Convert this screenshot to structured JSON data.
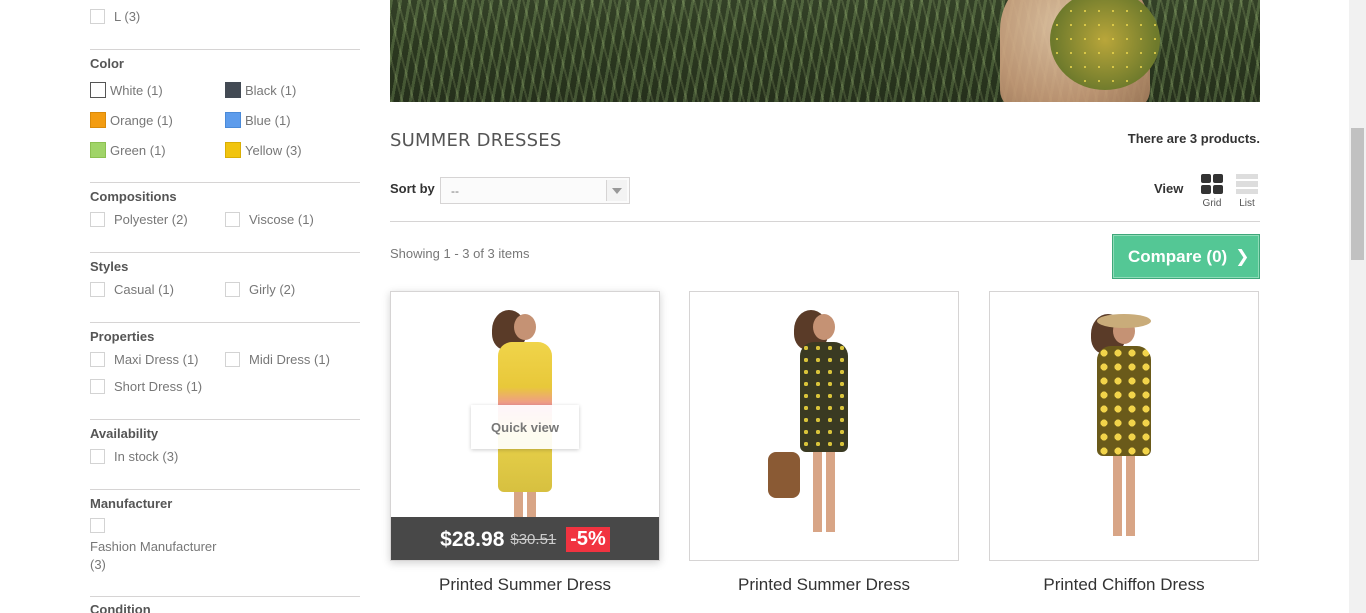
{
  "sidebar": {
    "size": {
      "item_l": "L (3)"
    },
    "color": {
      "title": "Color",
      "items": [
        {
          "label": "White (1)",
          "hex": "#ffffff"
        },
        {
          "label": "Black (1)",
          "hex": "#434a54"
        },
        {
          "label": "Orange (1)",
          "hex": "#f39c11"
        },
        {
          "label": "Blue (1)",
          "hex": "#5d9cec"
        },
        {
          "label": "Green (1)",
          "hex": "#a0d468"
        },
        {
          "label": "Yellow (3)",
          "hex": "#f1c40f"
        }
      ]
    },
    "compositions": {
      "title": "Compositions",
      "items": [
        "Polyester (2)",
        "Viscose (1)"
      ]
    },
    "styles": {
      "title": "Styles",
      "items": [
        "Casual (1)",
        "Girly (2)"
      ]
    },
    "properties": {
      "title": "Properties",
      "items": [
        "Maxi Dress (1)",
        "Midi Dress (1)",
        "Short Dress (1)"
      ]
    },
    "availability": {
      "title": "Availability",
      "items": [
        "In stock (3)"
      ]
    },
    "manufacturer": {
      "title": "Manufacturer",
      "items": [
        "Fashion Manufacturer",
        "(3)"
      ]
    },
    "condition": {
      "title": "Condition"
    }
  },
  "main": {
    "category_title": "SUMMER DRESSES",
    "product_count": "There are 3 products.",
    "sort_label": "Sort by",
    "sort_value": "--",
    "view_label": "View",
    "view_grid": "Grid",
    "view_list": "List",
    "showing": "Showing 1 - 3 of 3 items",
    "compare_label": "Compare (0)",
    "compare_icon": "chevron-right-icon"
  },
  "products": [
    {
      "name": "Printed Summer Dress",
      "quick_view": "Quick view",
      "price": "$28.98",
      "old_price": "$30.51",
      "discount": "-5%"
    },
    {
      "name": "Printed Summer Dress"
    },
    {
      "name": "Printed Chiffon Dress"
    }
  ]
}
